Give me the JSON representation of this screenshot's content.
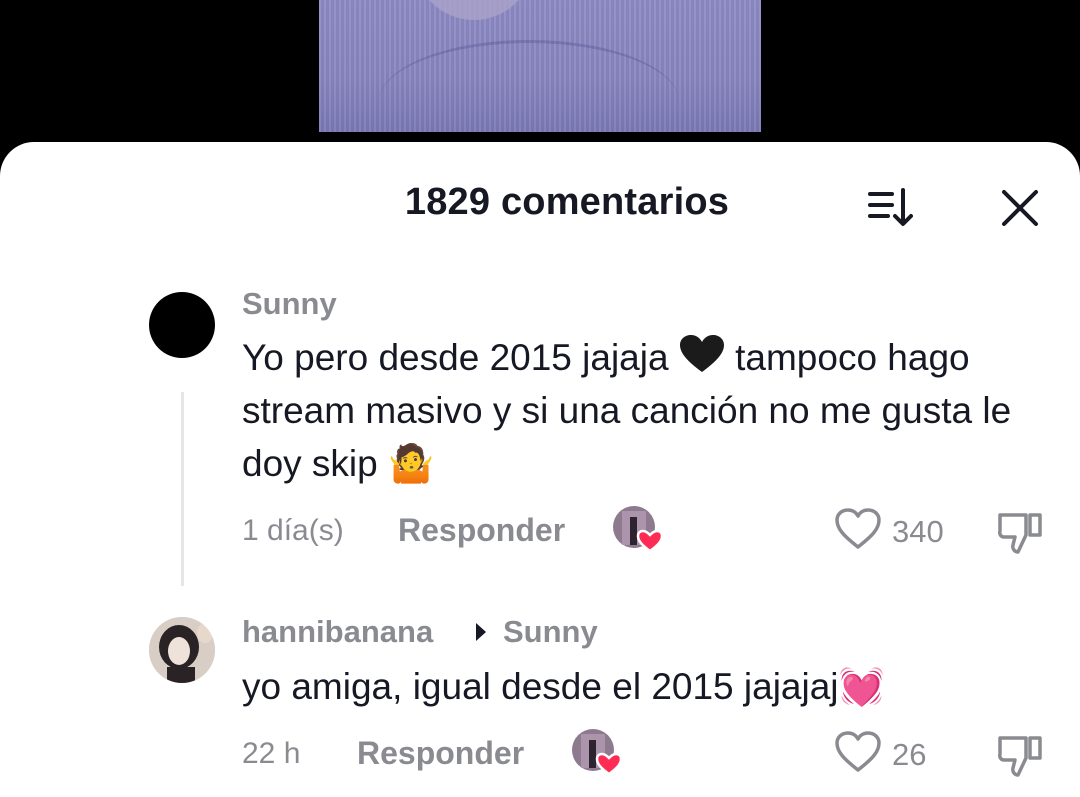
{
  "header": {
    "title": "1829 comentarios",
    "sort_icon": "sort-icon",
    "close_icon": "close-icon"
  },
  "comments": [
    {
      "username": "Sunny",
      "text_before_emoji": "Yo pero desde 2015 jajaja ",
      "emoji_1": "black-heart",
      "text_middle": " tampoco hago stream masivo y si una canción no me gusta le doy skip ",
      "emoji_2": "🤷",
      "time": "1 día(s)",
      "reply_label": "Responder",
      "likes": "340"
    },
    {
      "username": "hannibanana",
      "reply_to": "Sunny",
      "text": "yo amiga, igual desde el 2015 jajajaj",
      "emoji": "💓",
      "time": "22 h",
      "reply_label": "Responder",
      "likes": "26"
    }
  ],
  "colors": {
    "primary_text": "#161823",
    "secondary_text": "#8a8b91",
    "heart_red": "#fe2c55",
    "sheet_bg": "#ffffff"
  }
}
